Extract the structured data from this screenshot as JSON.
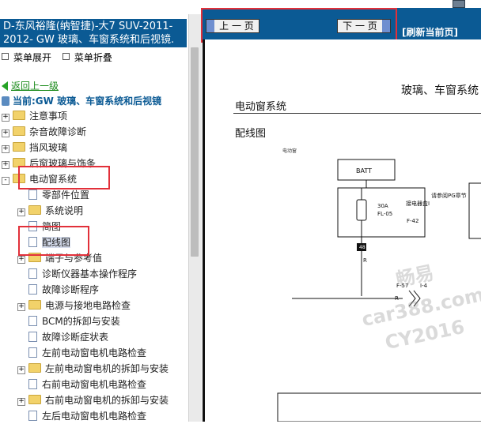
{
  "left_panel": {
    "title": "D-东风裕隆(纳智捷)-大7 SUV-2011-2012- GW 玻璃、车窗系统和后视镜.",
    "menu_expand": "菜单展开",
    "menu_collapse": "菜单折叠",
    "back_link": "返回上一级",
    "current": "当前:GW 玻璃、车窗系统和后视镜",
    "tree": [
      {
        "label": "注意事项",
        "type": "folder",
        "level": 0,
        "expander": "+"
      },
      {
        "label": "杂音故障诊断",
        "type": "folder",
        "level": 0,
        "expander": "+"
      },
      {
        "label": "挡风玻璃",
        "type": "folder",
        "level": 0,
        "expander": "+"
      },
      {
        "label": "后窗玻璃与饰条",
        "type": "folder",
        "level": 0,
        "expander": "+"
      },
      {
        "label": "电动窗系统",
        "type": "folder",
        "level": 0,
        "expander": "-"
      },
      {
        "label": "零部件位置",
        "type": "doc",
        "level": 1,
        "expander": ""
      },
      {
        "label": "系统说明",
        "type": "folder",
        "level": 1,
        "expander": "+"
      },
      {
        "label": "简图",
        "type": "doc",
        "level": 1,
        "expander": ""
      },
      {
        "label": "配线图",
        "type": "doc",
        "level": 1,
        "expander": "",
        "selected": true
      },
      {
        "label": "端子与参考值",
        "type": "folder",
        "level": 1,
        "expander": "+"
      },
      {
        "label": "诊断仪器基本操作程序",
        "type": "doc",
        "level": 1,
        "expander": ""
      },
      {
        "label": "故障诊断程序",
        "type": "doc",
        "level": 1,
        "expander": ""
      },
      {
        "label": "电源与接地电路检查",
        "type": "folder",
        "level": 1,
        "expander": "+"
      },
      {
        "label": "BCM的拆卸与安装",
        "type": "doc",
        "level": 1,
        "expander": ""
      },
      {
        "label": "故障诊断症状表",
        "type": "doc",
        "level": 1,
        "expander": ""
      },
      {
        "label": "左前电动窗电机电路检查",
        "type": "doc",
        "level": 1,
        "expander": ""
      },
      {
        "label": "左前电动窗电机的拆卸与安装",
        "type": "folder",
        "level": 1,
        "expander": "+"
      },
      {
        "label": "右前电动窗电机电路检查",
        "type": "doc",
        "level": 1,
        "expander": ""
      },
      {
        "label": "右前电动窗电机的拆卸与安装",
        "type": "folder",
        "level": 1,
        "expander": "+"
      },
      {
        "label": "左后电动窗电机电路检查",
        "type": "doc",
        "level": 1,
        "expander": ""
      }
    ]
  },
  "navbar": {
    "prev_label": "上 一 页",
    "next_label": "下 一 页",
    "refresh_label": "[刷新当前页]"
  },
  "document": {
    "title": "玻璃、车窗系统",
    "section": "电动窗系统",
    "subsection": "配线图",
    "tiny_label": "电动窗"
  },
  "diagram": {
    "batt_label": "BATT",
    "fuse_amp": "30A",
    "fuse_id": "FL-05",
    "relay_box_label": "接电器盒I",
    "relay_box_id": "F-42",
    "side_note": "请参阅PG章节",
    "pin_48": "48",
    "wire_r": "R",
    "conn_left": "F-57",
    "conn_right": "I-4"
  },
  "watermarks": [
    "畅易",
    "car388.com",
    "CY2016"
  ],
  "colors": {
    "header_blue": "#0b5a94",
    "highlight_red": "#e2303a",
    "back_link_green": "#1a8a1a"
  }
}
